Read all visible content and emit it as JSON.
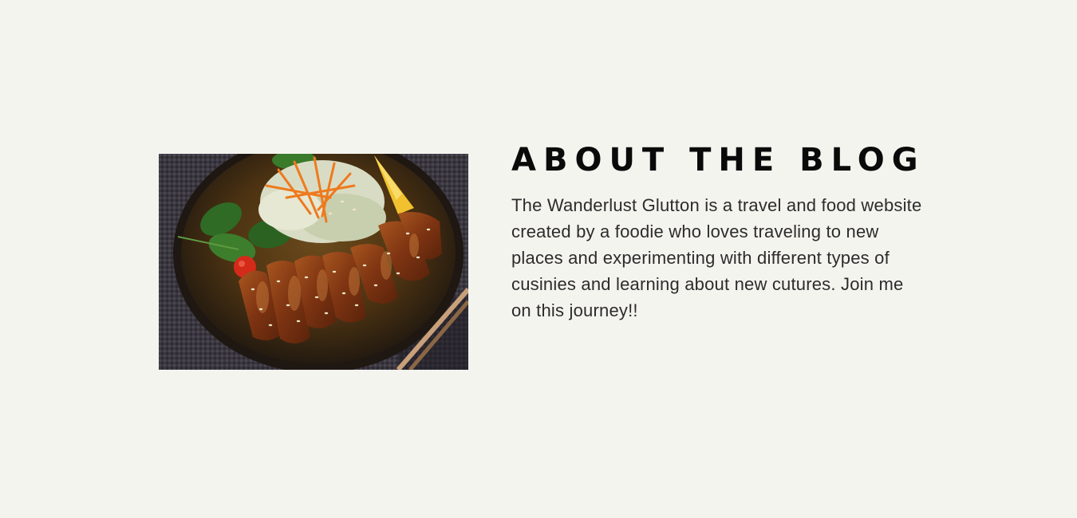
{
  "about": {
    "title": "ABOUT THE BLOG",
    "description": "The Wanderlust Glutton is a travel and food website created by a foodie who loves traveling to new places and experimenting with different types of cusinies and learning about new cutures. Join me on this journey!!"
  },
  "photo": {
    "subject": "grilled chicken plate with salad"
  },
  "colors": {
    "background": "#f4f4ef",
    "title": "#0a0a0a",
    "text": "#2e2b2b"
  }
}
